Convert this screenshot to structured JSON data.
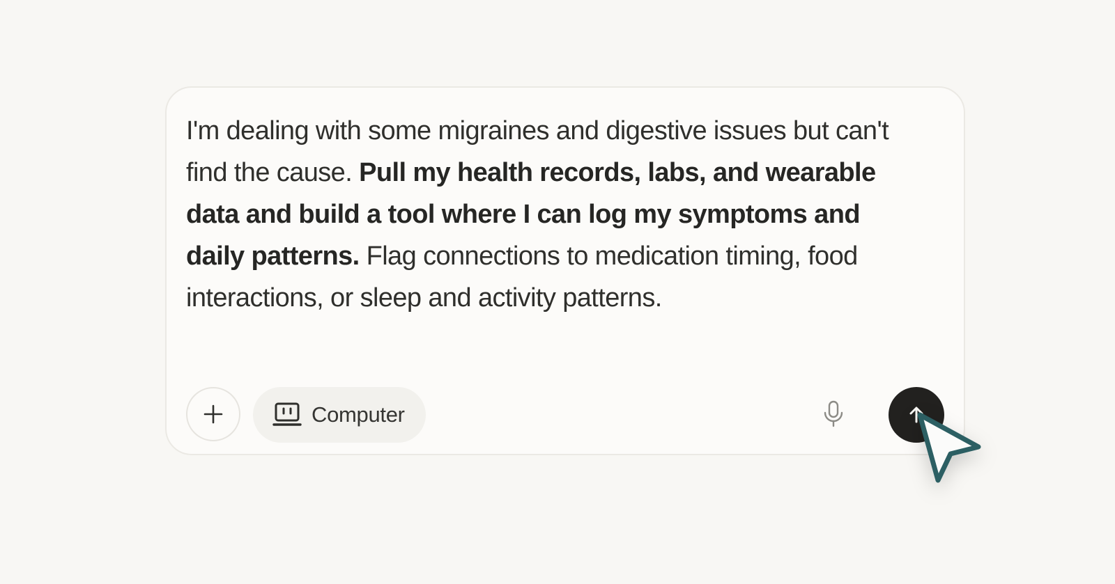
{
  "prompt": {
    "text_before": "I'm dealing with some migraines and digestive issues but can't find the cause. ",
    "text_bold": "Pull my health records, labs, and wearable data  and build a tool where I can log my symptoms and daily patterns.",
    "text_after": " Flag connections to medication timing, food interactions, or sleep and activity patterns."
  },
  "toolbar": {
    "add_icon": "plus-icon",
    "computer_label": "Computer",
    "computer_icon": "computer-icon",
    "mic_icon": "microphone-icon",
    "send_icon": "arrow-up-icon"
  },
  "cursor": {
    "icon": "pointer-cursor-icon",
    "color": "#2c5f63"
  },
  "colors": {
    "background": "#f8f7f4",
    "composer": "#fcfbf9",
    "send_button": "#22211f"
  }
}
